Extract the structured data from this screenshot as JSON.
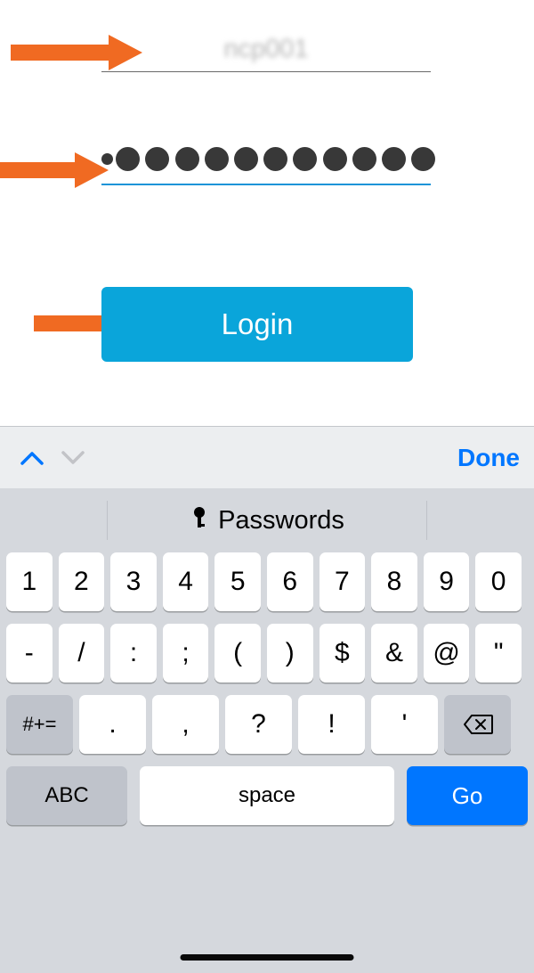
{
  "form": {
    "username_value": "ncp001",
    "password_dot_count": 11,
    "login_label": "Login"
  },
  "accessory": {
    "done_label": "Done"
  },
  "suggest": {
    "passwords_label": "Passwords"
  },
  "keyboard": {
    "row1": [
      "1",
      "2",
      "3",
      "4",
      "5",
      "6",
      "7",
      "8",
      "9",
      "0"
    ],
    "row2": [
      "-",
      "/",
      ":",
      ";",
      "(",
      ")",
      "$",
      "&",
      "@",
      "\""
    ],
    "row3_mod": "#+=",
    "row3_keys": [
      ".",
      ",",
      "?",
      "!",
      "'"
    ],
    "row4_abc": "ABC",
    "row4_space": "space",
    "row4_go": "Go"
  }
}
